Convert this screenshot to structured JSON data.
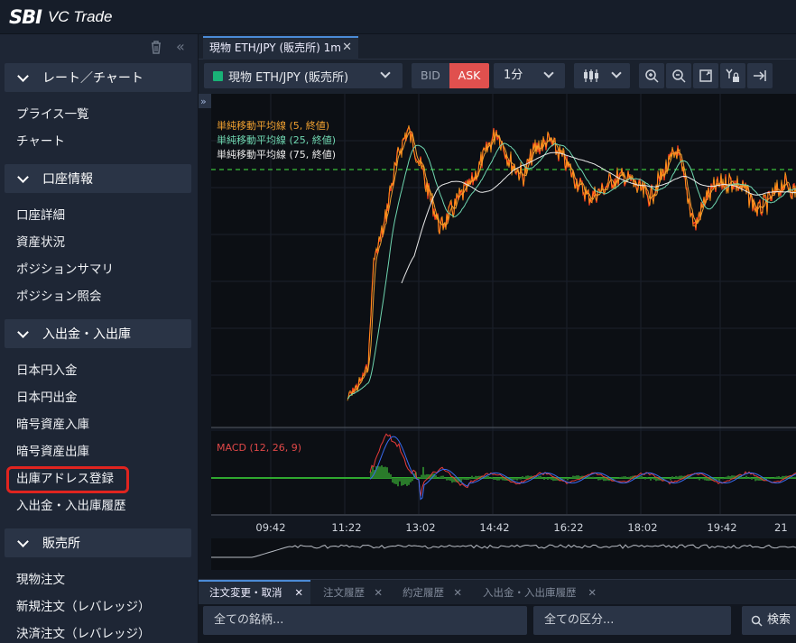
{
  "app": {
    "brand": "SBI",
    "product": "VC Trade"
  },
  "sidebar": {
    "sections": [
      {
        "title": "レート／チャート",
        "items": [
          "プライス一覧",
          "チャート"
        ]
      },
      {
        "title": "口座情報",
        "items": [
          "口座詳細",
          "資産状況",
          "ポジションサマリ",
          "ポジション照会"
        ]
      },
      {
        "title": "入出金・入出庫",
        "items": [
          "日本円入金",
          "日本円出金",
          "暗号資産入庫",
          "暗号資産出庫",
          "出庫アドレス登録",
          "入出金・入出庫履歴"
        ]
      },
      {
        "title": "販売所",
        "items": [
          "現物注文",
          "新規注文（レバレッジ）",
          "決済注文（レバレッジ）"
        ]
      }
    ]
  },
  "tab": {
    "label": "現物 ETH/JPY (販売所) 1m"
  },
  "toolbar": {
    "symbol": "現物 ETH/JPY (販売所)",
    "bid": "BID",
    "ask": "ASK",
    "timeframe": "1分"
  },
  "chart": {
    "legend": [
      "単純移動平均線 (5, 終値)",
      "単純移動平均線 (25, 終値)",
      "単純移動平均線 (75, 終値)"
    ],
    "legend_colors": [
      "#f0a030",
      "#6fd6b0",
      "#e8e8e8"
    ],
    "macd_label": "MACD (12, 26, 9)",
    "x_ticks": [
      "09:42",
      "11:22",
      "13:02",
      "14:42",
      "16:22",
      "18:02",
      "19:42",
      "21"
    ]
  },
  "bottom": {
    "tabs": [
      "注文変更・取消",
      "注文履歴",
      "約定履歴",
      "入出金・入出庫履歴"
    ],
    "filter_symbol": "全ての銘柄...",
    "filter_type": "全ての区分...",
    "search": "検索"
  }
}
